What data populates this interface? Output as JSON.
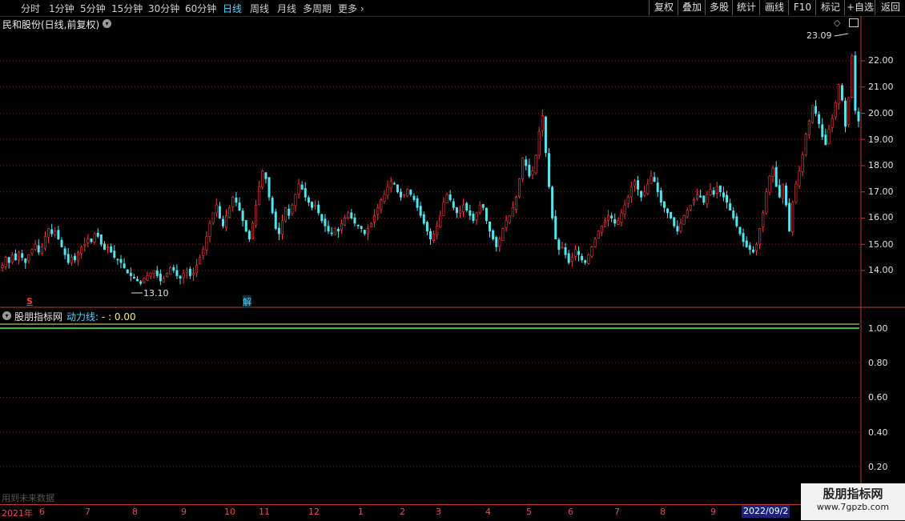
{
  "toolbar": {
    "periods": [
      "分时",
      "1分钟",
      "5分钟",
      "15分钟",
      "30分钟",
      "60分钟",
      "日线",
      "周线",
      "月线",
      "多周期",
      "更多"
    ],
    "active_period": "日线",
    "more_arrow": "›",
    "right_buttons": [
      "复权",
      "叠加",
      "多股",
      "统计",
      "画线",
      "F10",
      "标记",
      "+自选",
      "返回"
    ]
  },
  "stock": {
    "title": "民和股份(日线,前复权)",
    "price_axis": [
      "22.00",
      "21.00",
      "20.00",
      "19.00",
      "18.00",
      "17.00",
      "16.00",
      "15.00",
      "14.00"
    ],
    "high_label": "23.09",
    "low_label": "13.10",
    "marker_s": "S",
    "marker_jie": "解"
  },
  "indicator": {
    "name": "股朋指标网",
    "line_name": "动力线:",
    "line_value": " - : 0.00",
    "axis": [
      "1.00",
      "0.80",
      "0.60",
      "0.40",
      "0.20"
    ]
  },
  "footer": {
    "future_note": "用到未来数据",
    "date_labels": [
      "2021年",
      "6",
      "7",
      "8",
      "9",
      "10",
      "11",
      "12",
      "1",
      "2",
      "3",
      "4",
      "5",
      "6",
      "7",
      "8",
      "9"
    ],
    "cursor_date": "2022/09/2"
  },
  "watermark": {
    "title": "股朋指标网",
    "url": "www.7gpzb.com"
  },
  "colors": {
    "up": "#ff3b3b",
    "down": "#54e5f0",
    "grid": "#8b1a1a",
    "line1": "#f0e68c",
    "line2": "#30c030"
  },
  "chart_data": {
    "type": "candlestick",
    "y_axis": [
      14,
      22
    ],
    "closes": [
      14.2,
      14.5,
      14.3,
      14.6,
      14.4,
      14.7,
      14.5,
      14.3,
      14.6,
      14.8,
      15.0,
      14.7,
      14.9,
      15.3,
      15.6,
      15.4,
      15.5,
      15.2,
      14.9,
      14.6,
      14.3,
      14.5,
      14.4,
      14.7,
      14.9,
      15.0,
      15.2,
      15.1,
      15.4,
      15.3,
      15.0,
      14.8,
      14.9,
      14.7,
      14.5,
      14.4,
      14.3,
      14.1,
      13.9,
      13.8,
      13.7,
      13.6,
      13.5,
      13.7,
      13.8,
      13.9,
      14.0,
      13.8,
      13.6,
      13.7,
      13.9,
      14.1,
      14.0,
      13.8,
      13.7,
      13.9,
      14.0,
      13.8,
      13.9,
      14.2,
      14.5,
      14.8,
      15.3,
      15.8,
      16.2,
      16.5,
      16.0,
      15.7,
      16.1,
      16.4,
      16.8,
      16.6,
      16.3,
      15.9,
      15.5,
      15.2,
      15.8,
      16.5,
      17.2,
      17.8,
      17.5,
      16.8,
      16.2,
      15.6,
      15.4,
      15.9,
      16.4,
      16.1,
      16.5,
      16.9,
      17.3,
      17.1,
      16.8,
      16.6,
      16.4,
      16.5,
      16.2,
      15.9,
      15.7,
      15.5,
      15.4,
      15.6,
      15.5,
      15.8,
      16.0,
      16.2,
      16.0,
      15.8,
      15.7,
      15.6,
      15.4,
      15.6,
      15.8,
      16.1,
      16.4,
      16.7,
      16.9,
      17.2,
      17.4,
      17.3,
      17.0,
      16.8,
      16.9,
      17.1,
      16.9,
      16.7,
      16.4,
      16.1,
      15.8,
      15.5,
      15.2,
      15.4,
      15.7,
      16.1,
      16.6,
      16.9,
      16.7,
      16.4,
      16.2,
      16.3,
      16.5,
      16.3,
      16.1,
      15.9,
      16.2,
      16.5,
      16.4,
      15.9,
      15.5,
      15.2,
      14.9,
      15.2,
      15.6,
      15.9,
      16.1,
      16.4,
      16.8,
      17.5,
      18.3,
      18.0,
      17.6,
      17.8,
      18.4,
      19.3,
      19.9,
      18.5,
      17.2,
      16.0,
      15.2,
      14.8,
      14.9,
      14.6,
      14.3,
      14.5,
      14.8,
      14.6,
      14.4,
      14.3,
      14.6,
      14.9,
      15.2,
      15.5,
      15.7,
      15.9,
      16.1,
      16.0,
      15.8,
      15.9,
      16.2,
      16.5,
      16.8,
      17.2,
      17.4,
      17.1,
      16.8,
      17.0,
      17.3,
      17.6,
      17.4,
      17.0,
      16.6,
      16.4,
      16.2,
      16.0,
      15.7,
      15.5,
      15.8,
      16.1,
      16.3,
      16.5,
      16.7,
      16.9,
      16.8,
      16.6,
      16.9,
      17.1,
      16.9,
      17.2,
      17.0,
      16.8,
      16.6,
      16.3,
      16.0,
      15.7,
      15.4,
      15.1,
      14.9,
      14.8,
      14.7,
      15.0,
      15.6,
      16.2,
      17.0,
      17.6,
      17.9,
      17.2,
      16.8,
      17.3,
      16.5,
      15.5,
      16.6,
      17.3,
      17.8,
      18.4,
      19.2,
      19.7,
      20.3,
      20.0,
      19.6,
      19.1,
      18.8,
      19.4,
      19.8,
      20.4,
      21.1,
      20.5,
      19.5,
      20.6,
      22.2,
      20.1,
      19.7
    ]
  }
}
